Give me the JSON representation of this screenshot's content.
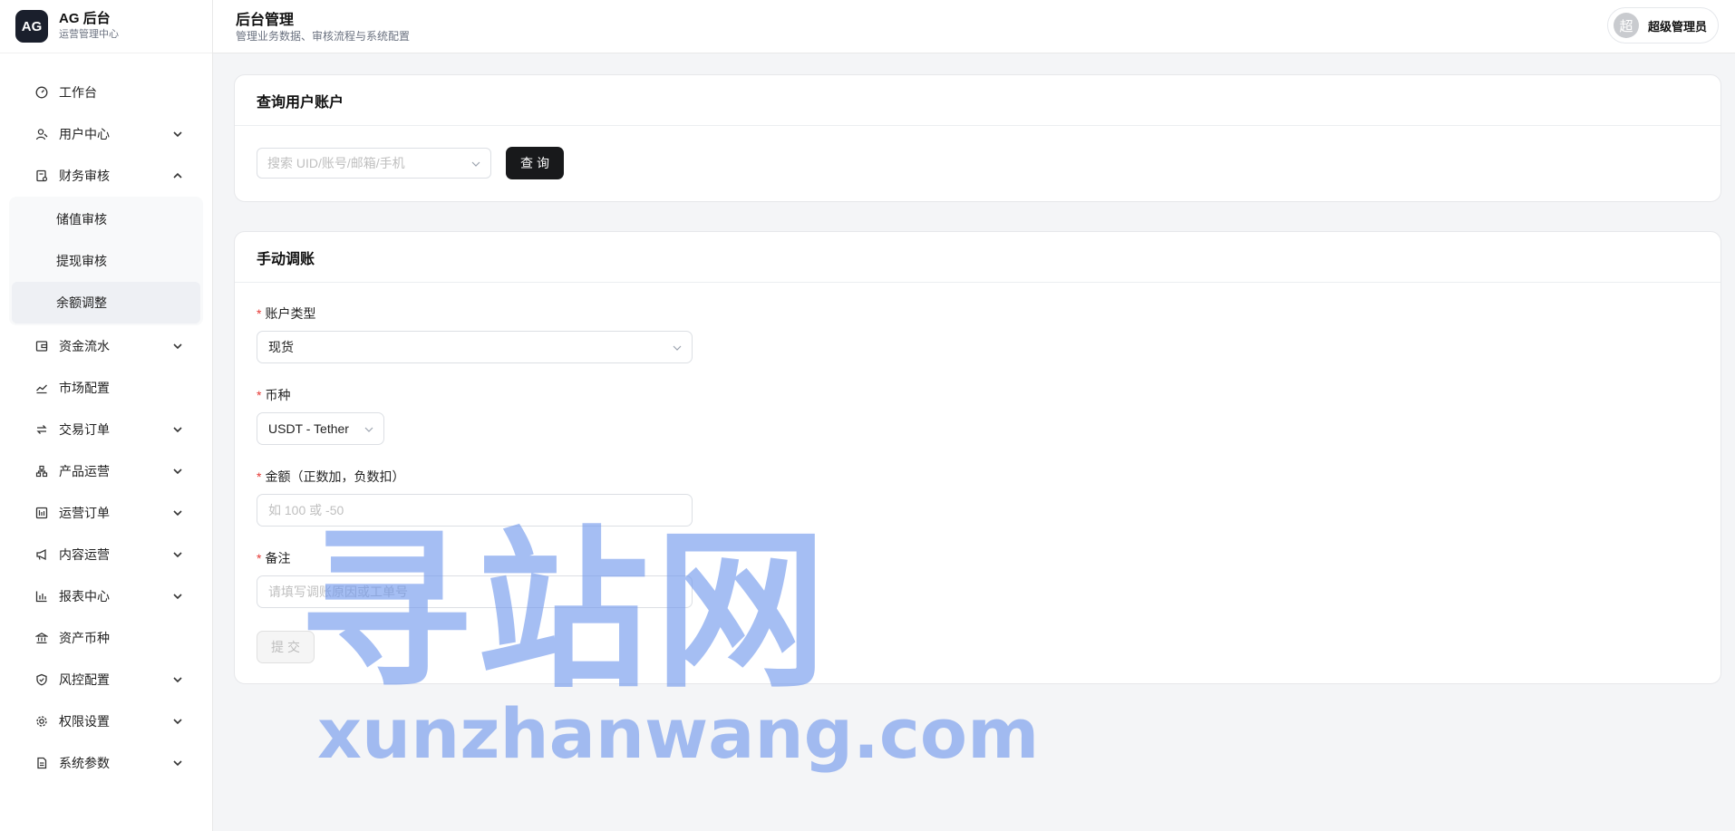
{
  "brand": {
    "logo": "AG",
    "title": "AG 后台",
    "subtitle": "运营管理中心"
  },
  "header": {
    "title": "后台管理",
    "subtitle": "管理业务数据、审核流程与系统配置"
  },
  "user": {
    "avatar_char": "超",
    "name": "超级管理员"
  },
  "sidebar": {
    "items": [
      {
        "label": "工作台",
        "icon": "dashboard-icon"
      },
      {
        "label": "用户中心",
        "icon": "users-icon",
        "chevron": "down"
      },
      {
        "label": "财务审核",
        "icon": "finance-audit-icon",
        "chevron": "up"
      },
      {
        "label": "资金流水",
        "icon": "wallet-icon",
        "chevron": "down"
      },
      {
        "label": "市场配置",
        "icon": "line-chart-icon"
      },
      {
        "label": "交易订单",
        "icon": "swap-icon",
        "chevron": "down"
      },
      {
        "label": "产品运营",
        "icon": "cluster-icon",
        "chevron": "down"
      },
      {
        "label": "运营订单",
        "icon": "bar-order-icon",
        "chevron": "down"
      },
      {
        "label": "内容运营",
        "icon": "megaphone-icon",
        "chevron": "down"
      },
      {
        "label": "报表中心",
        "icon": "bar-chart-icon",
        "chevron": "down"
      },
      {
        "label": "资产币种",
        "icon": "bank-icon"
      },
      {
        "label": "风控配置",
        "icon": "shield-icon",
        "chevron": "down"
      },
      {
        "label": "权限设置",
        "icon": "gear-icon",
        "chevron": "down"
      },
      {
        "label": "系统参数",
        "icon": "document-icon",
        "chevron": "down"
      }
    ],
    "finance_sub": [
      {
        "label": "储值审核"
      },
      {
        "label": "提现审核"
      },
      {
        "label": "余额调整",
        "active": true
      }
    ]
  },
  "query_card": {
    "title": "查询用户账户",
    "search_placeholder": "搜索 UID/账号/邮箱/手机",
    "query_button": "查询"
  },
  "adjust_card": {
    "title": "手动调账",
    "required_mark": "*",
    "account_type": {
      "label": "账户类型",
      "value": "现货"
    },
    "currency": {
      "label": "币种",
      "value": "USDT - Tether"
    },
    "amount": {
      "label": "金额（正数加，负数扣）",
      "placeholder": "如 100 或 -50"
    },
    "remark": {
      "label": "备注",
      "placeholder": "请填写调账原因或工单号"
    },
    "submit_button": "提交"
  },
  "watermark": {
    "cn": "寻站网",
    "en": "xunzhanwang.com"
  }
}
